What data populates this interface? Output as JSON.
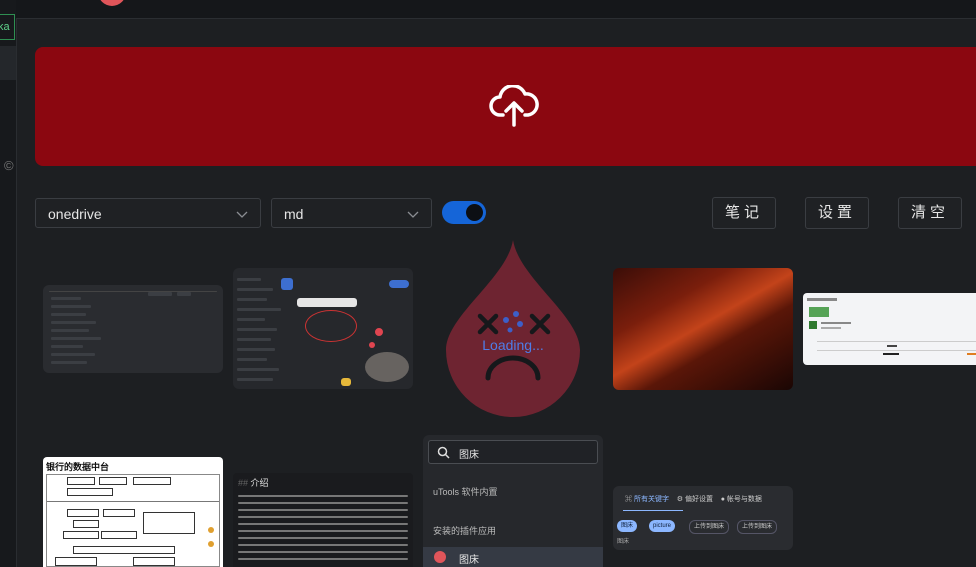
{
  "sidebar": {
    "tag_text": "ka",
    "copyright_symbol": "©"
  },
  "upload": {
    "icon": "cloud-upload-icon"
  },
  "controls": {
    "storage_select": {
      "value": "onedrive"
    },
    "format_select": {
      "value": "md"
    },
    "toggle": {
      "on": true
    },
    "notes_button": "笔记",
    "settings_button": "设置",
    "clear_button": "清空"
  },
  "gallery": {
    "loading_text": "Loading...",
    "thumb_bank_title": "银行的数据中台",
    "thumb_intro_heading": "介绍",
    "thumb_intro_hash": "##",
    "thumb_search": {
      "query": "图床",
      "section1": "uTools 软件内置",
      "section2": "安装的插件应用",
      "selected_item": "图床"
    },
    "thumb_settings": {
      "tab_keywords": "所有关键字",
      "tab_prefs": "偏好设置",
      "tab_account": "帐号与数据",
      "chip1": "图床",
      "chip2": "picture",
      "chip3": "上传到图床",
      "chip4": "上传到图床",
      "label": "图床"
    }
  },
  "colors": {
    "upload_bg": "#8b0710",
    "toggle_on": "#1565d8",
    "loading_drop": "#6e2431",
    "loading_text": "#4f7de8"
  }
}
